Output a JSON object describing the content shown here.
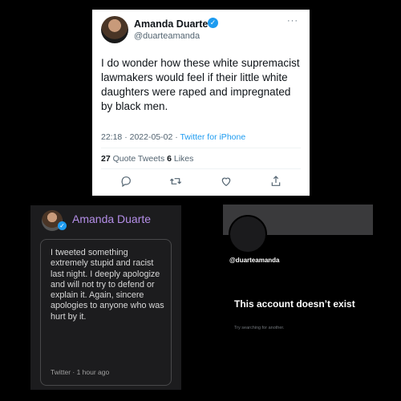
{
  "tweet": {
    "display_name": "Amanda Duarte",
    "handle": "@duarteamanda",
    "more_icon": "···",
    "text": "I do wonder how these white supremacist lawmakers would feel if their little white daughters were raped and impregnated by black men.",
    "timestamp": "22:18 · 2022-05-02 · ",
    "source": "Twitter for iPhone",
    "quote_count": "27",
    "quote_label": " Quote Tweets ",
    "like_count": "6",
    "like_label": " Likes",
    "verified_glyph": "✓",
    "action_icons": [
      "reply-icon",
      "retweet-icon",
      "like-icon",
      "share-icon"
    ],
    "accent_color": "#1d9bf0"
  },
  "apology": {
    "display_name": "Amanda Duarte",
    "verified_glyph": "✓",
    "text": "I tweeted something extremely stupid and racist last night. I deeply apologize and will not try to defend or explain it. Again, sincere apologies to anyone who was hurt by it.",
    "footer": "Twitter · 1 hour ago",
    "name_color": "#b48ee8"
  },
  "deleted_account": {
    "handle": "@duarteamanda",
    "title": "This account doesn’t exist",
    "subtitle": "Try searching for another."
  }
}
